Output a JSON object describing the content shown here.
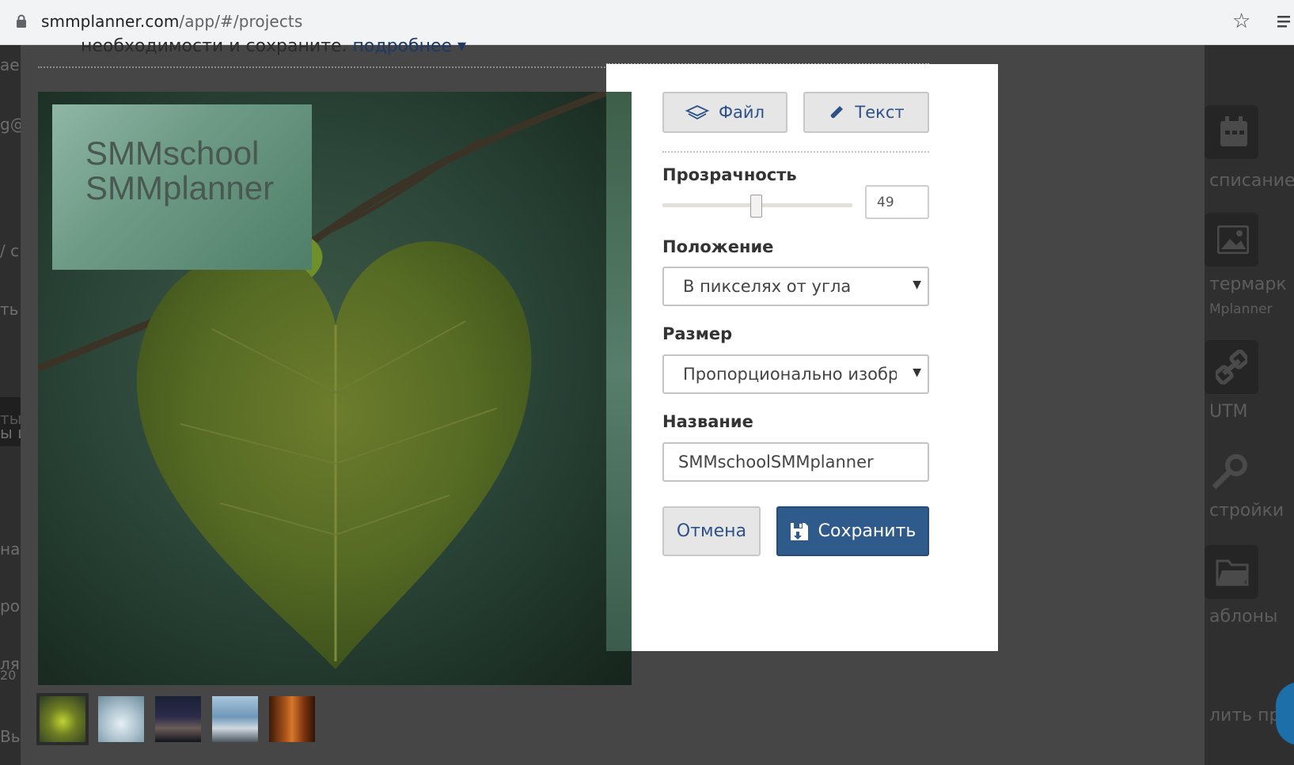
{
  "browser": {
    "url_host": "smmplanner.com",
    "url_path": "/app/#/projects"
  },
  "background": {
    "info_text": "необходимости и сохраните.",
    "info_more": "подробнее ▾",
    "left_fragments": [
      "ае",
      "g@",
      "/ с",
      "ть",
      "ты",
      "ы и",
      "на",
      "ро",
      "ля",
      "20",
      "Вы"
    ],
    "right_labels": [
      "списание",
      "термарк",
      "Mplanner",
      "UTM",
      "стройки",
      "аблоны",
      "лить про"
    ]
  },
  "preview": {
    "watermark_line1": "SMMschool",
    "watermark_line2": "SMMplanner",
    "thumbnails": [
      "heart-leaf",
      "snow-crystal",
      "night-mountain",
      "sky-road",
      "autumn-forest"
    ]
  },
  "modal": {
    "file_button": "Файл",
    "text_button": "Текст",
    "opacity_label": "Прозрачность",
    "opacity_value": "49",
    "opacity_fraction": 0.49,
    "position_label": "Положение",
    "position_value": "В пикселях от угла",
    "size_label": "Размер",
    "size_value": "Пропорционально изображению",
    "name_label": "Название",
    "name_value": "SMMschoolSMMplanner",
    "cancel_button": "Отмена",
    "save_button": "Сохранить"
  },
  "colors": {
    "primary": "#2e5a8c",
    "link": "#2d5288"
  }
}
